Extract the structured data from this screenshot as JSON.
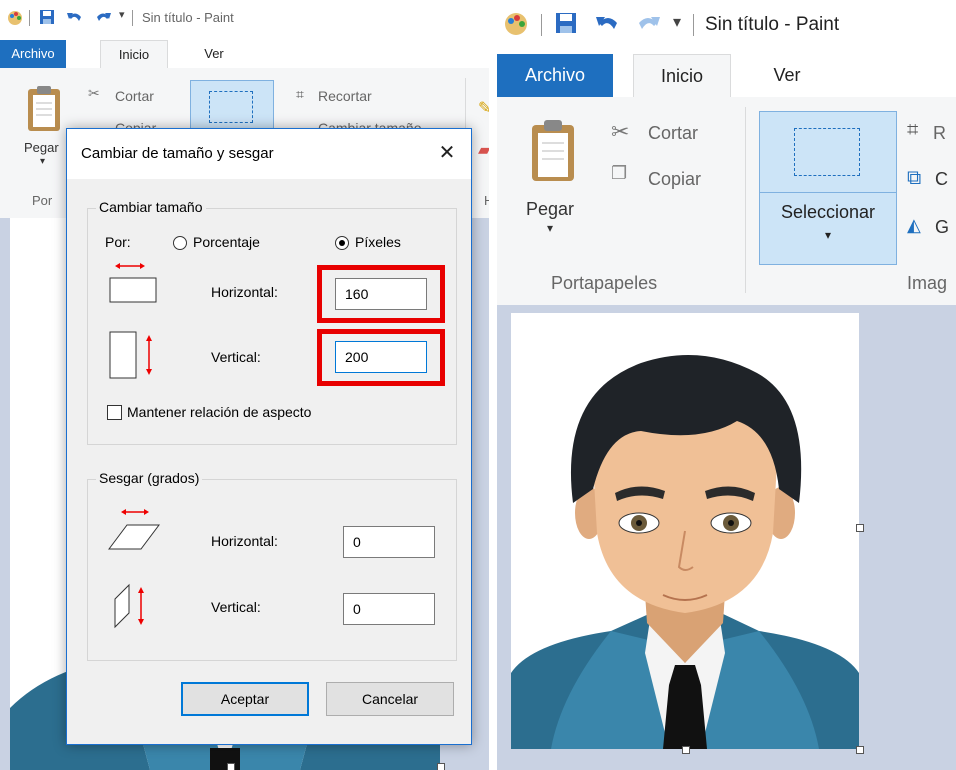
{
  "app": {
    "title": "Sin título - Paint",
    "tabs": [
      "Archivo",
      "Inicio",
      "Ver"
    ],
    "clipboard": {
      "paste": "Pegar",
      "cut": "Cortar",
      "copy": "Copiar",
      "group": "Portapapeles"
    },
    "image": {
      "select": "Seleccionar",
      "crop": "Recortar",
      "resize": "Cambiar tamaño",
      "group": "Imagen"
    },
    "left_partial": {
      "paste_short": "Pegar",
      "group_short": "Por",
      "copy_partial": "Copiar",
      "tools_partial": "He",
      "resize_partial": "Cambiar tamaño"
    },
    "right_partial": {
      "crop_letter": "R",
      "resize_letter": "C",
      "rotate_letter": "G",
      "image_group_partial": "Imag"
    }
  },
  "dialog": {
    "title": "Cambiar de tamaño y sesgar",
    "resize_group": "Cambiar tamaño",
    "by_label": "Por:",
    "percent_label": "Porcentaje",
    "pixels_label": "Píxeles",
    "selected_unit": "Píxeles",
    "horizontal_label": "Horizontal:",
    "horizontal_value": "160",
    "vertical_label": "Vertical:",
    "vertical_value": "200",
    "keep_aspect_label": "Mantener relación de aspecto",
    "keep_aspect_checked": false,
    "skew_group": "Sesgar (grados)",
    "skew_horizontal_label": "Horizontal:",
    "skew_horizontal_value": "0",
    "skew_vertical_label": "Vertical:",
    "skew_vertical_value": "0",
    "ok_label": "Aceptar",
    "cancel_label": "Cancelar"
  },
  "colors": {
    "file_tab": "#1e6fbf",
    "highlight": "#e80000",
    "workspace": "#c9d2e3",
    "select_active": "#cce4f7"
  }
}
